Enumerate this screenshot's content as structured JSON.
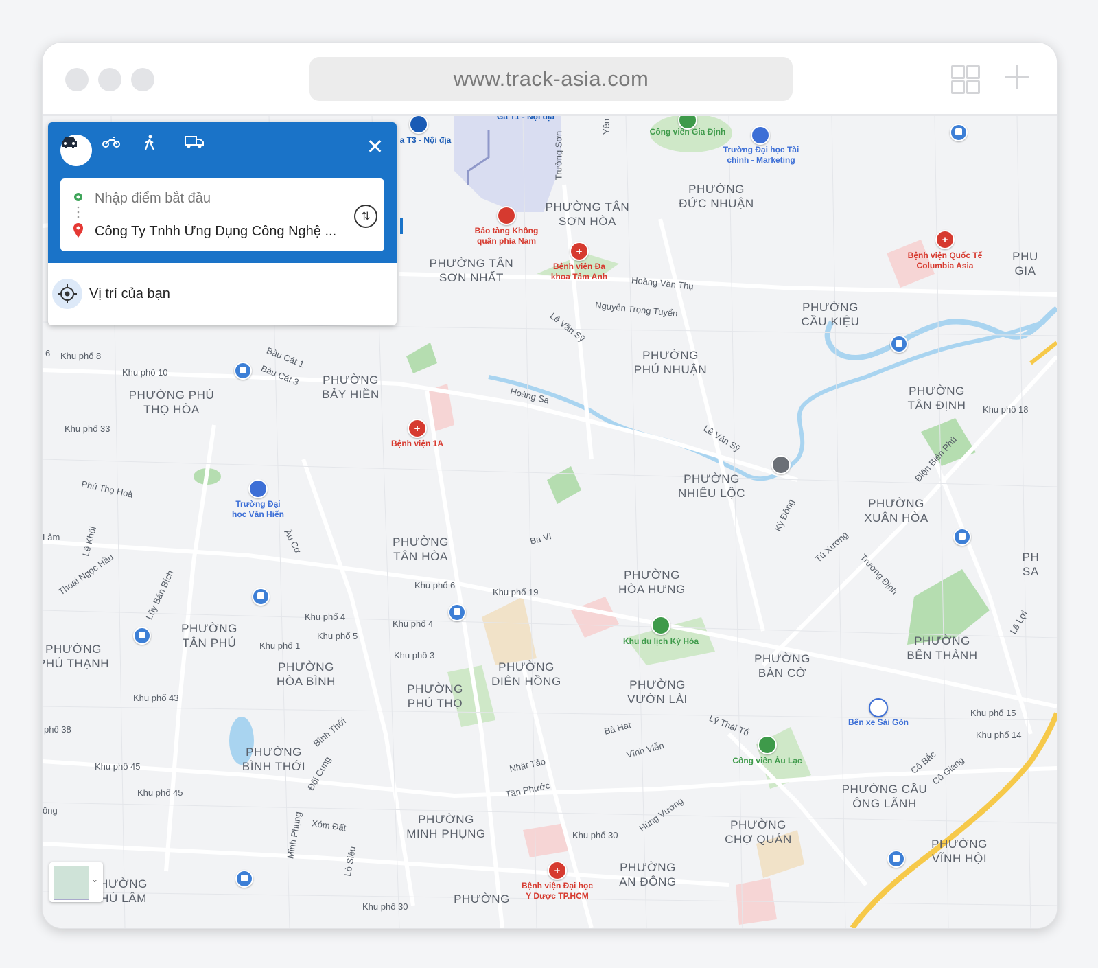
{
  "browser": {
    "url": "www.track-asia.com"
  },
  "directions": {
    "modes": [
      "car",
      "motorbike",
      "walk",
      "truck"
    ],
    "active_mode": "car",
    "start_placeholder": "Nhập điểm bắt đầu",
    "destination": "Công Ty Tnhh Ứng Dụng Công Nghệ ...",
    "your_location": "Vị trí của bạn"
  },
  "map": {
    "areas": [
      {
        "name": "PHƯỜNG\nĐỨC NHUẬN"
      },
      {
        "name": "PHƯỜNG TÂN\nSƠN HÒA"
      },
      {
        "name": "PHƯỜNG TÂN\nSƠN NHẤT"
      },
      {
        "name": "PHƯỜNG\nCẦU KIỆU"
      },
      {
        "name": "PHƯỜNG\nPHÚ NHUẬN"
      },
      {
        "name": "PHƯỜNG\nBẢY HIỀN"
      },
      {
        "name": "PHƯỜNG PHÚ\nTHỌ HÒA"
      },
      {
        "name": "PHƯỜNG\nTÂN ĐỊNH"
      },
      {
        "name": "PHƯỜNG\nNHIÊU LỘC"
      },
      {
        "name": "PHƯỜNG\nXUÂN HÒA"
      },
      {
        "name": "PHƯỜNG\nTÂN HÒA"
      },
      {
        "name": "PHƯỜNG\nHÒA HƯNG"
      },
      {
        "name": "PHƯỜNG\nTÂN PHÚ"
      },
      {
        "name": "PHƯỜNG\nPHÚ THẠNH"
      },
      {
        "name": "PHƯỜNG\nHÒA BÌNH"
      },
      {
        "name": "PHƯỜNG\nDIÊN HỒNG"
      },
      {
        "name": "PHƯỜNG\nPHÚ THỌ"
      },
      {
        "name": "PHƯỜNG\nVƯỜN LÀI"
      },
      {
        "name": "PHƯỜNG\nBÀN CỜ"
      },
      {
        "name": "PHƯỜNG\nBẾN THÀNH"
      },
      {
        "name": "PHƯỜNG\nBÌNH THỚI"
      },
      {
        "name": "PHƯỜNG CẦU\nÔNG LÃNH"
      },
      {
        "name": "PHƯỜNG\nMINH PHỤNG"
      },
      {
        "name": "PHƯỜNG\nCHỢ QUÁN"
      },
      {
        "name": "PHƯỜNG\nVĨNH HỘI"
      },
      {
        "name": "PHƯỜNG\nAN ĐÔNG"
      },
      {
        "name": "PHƯỜNG"
      },
      {
        "name": "HƯỜNG\nHÚ LÂM"
      },
      {
        "name": "PHU\nGIA"
      },
      {
        "name": "PH\nSA"
      }
    ],
    "streets": [
      "Hoàng Văn Thụ",
      "Nguyễn Trọng Tuyển",
      "Lê Văn Sỹ",
      "Hoàng Sa",
      "Lê Văn Sỹ",
      "Bàu Cát 1",
      "Bàu Cát 3",
      "Phú Thọ Hoà",
      "Lê Khôi",
      "Thoại Ngọc Hầu",
      "Lũy Bán Bích",
      "Âu Cơ",
      "Ba Vì",
      "Kỳ Đồng",
      "Tú Xương",
      "Trương Định",
      "Điện Biên Phủ",
      "Lý Thái Tổ",
      "Bà Hạt",
      "Vĩnh Viễn",
      "Nhật Tảo",
      "Tân Phước",
      "Hùng Vương",
      "Bình Thới",
      "Đội Cung",
      "Minh Phụng",
      "Xóm Đất",
      "Lò Siêu",
      "Cô Bắc",
      "Cô Giang",
      "Lê Lợi",
      "Trường Sơn",
      "Yên",
      "Lâm",
      "ông"
    ],
    "neighborhoods": [
      "Khu phố 8",
      "Khu phố 10",
      "Khu phố 33",
      "Khu phố 6",
      "Khu phố 19",
      "Khu phố 4",
      "Khu phố 5",
      "Khu phố 4",
      "Khu phố 1",
      "Khu phố 3",
      "Khu phố 43",
      "Khu phố 45",
      "Khu phố 45",
      "Khu phố 30",
      "Khu phố 18",
      "Khu phố 15",
      "Khu phố 14",
      "phố 38",
      "6",
      "Khu phố 30"
    ],
    "pois": [
      {
        "name": "Công viên Gia Định",
        "kind": "park"
      },
      {
        "name": "Trường Đại học Tài\nchính - Marketing",
        "kind": "school"
      },
      {
        "name": "Bảo tàng Không\nquân phía Nam",
        "kind": "museum"
      },
      {
        "name": "Bệnh viện Đa\nkhoa Tâm Anh",
        "kind": "hospital"
      },
      {
        "name": "Bệnh viện Quốc Tế\nColumbia Asia",
        "kind": "hospital"
      },
      {
        "name": "Bệnh viện 1A",
        "kind": "hospital"
      },
      {
        "name": "Trường Đại\nhọc Văn Hiến",
        "kind": "school"
      },
      {
        "name": "Khu du lịch Kỳ Hòa",
        "kind": "park"
      },
      {
        "name": "Bến xe Sài Gòn",
        "kind": "bus"
      },
      {
        "name": "Công viên Âu Lạc",
        "kind": "park"
      },
      {
        "name": "Bệnh viện Đại học\nY Dược TP.HCM",
        "kind": "hospital"
      },
      {
        "name": "a T3 - Nội địa",
        "kind": "airport"
      },
      {
        "name": "Ga T1 - Nội địa",
        "kind": "airport"
      }
    ]
  },
  "colors": {
    "panel_blue": "#1a73c8",
    "hospital_red": "#d63a2f",
    "park_green": "#3e9a4a",
    "school_blue": "#3d6fd6",
    "road_yellow": "#f6c94a",
    "river_blue": "#a9d4f0"
  }
}
